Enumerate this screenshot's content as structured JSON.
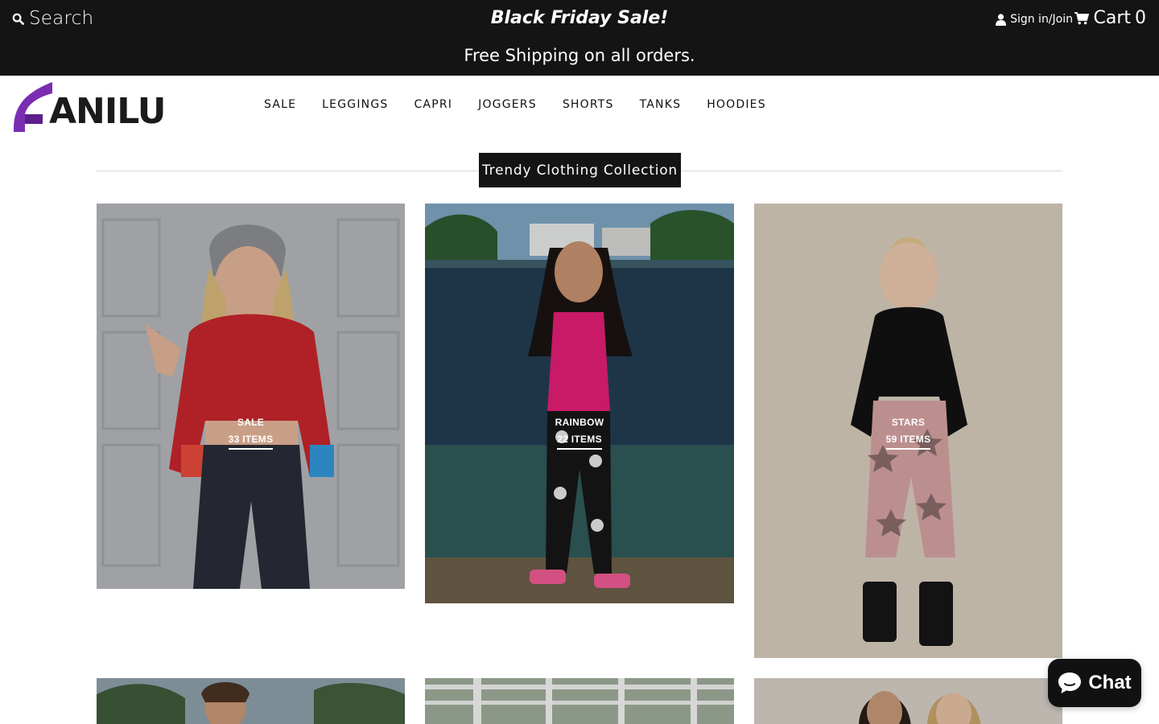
{
  "topbar": {
    "search_label": "Search",
    "promo_title": "Black Friday Sale!",
    "promo_subtitle": "Free Shipping on all orders.",
    "account_label": "Sign in/Join",
    "cart_label": "Cart",
    "cart_count": "0"
  },
  "brand": {
    "logo_text": "ANILU",
    "purple": "#7a2db3",
    "dark": "#1b1b1b"
  },
  "nav": {
    "items": [
      "SALE",
      "LEGGINGS",
      "CAPRI",
      "JOGGERS",
      "SHORTS",
      "TANKS",
      "HOODIES"
    ]
  },
  "section": {
    "title": "Trendy Clothing Collection"
  },
  "collections": [
    {
      "name": "SALE",
      "count": "33 ITEMS"
    },
    {
      "name": "RAINBOW",
      "count": "22 ITEMS"
    },
    {
      "name": "STARS",
      "count": "59 ITEMS"
    }
  ],
  "chat": {
    "label": "Chat"
  },
  "icons": {
    "search": "search-icon",
    "user": "user-icon",
    "cart": "cart-icon",
    "chat": "chat-bubble-icon"
  }
}
